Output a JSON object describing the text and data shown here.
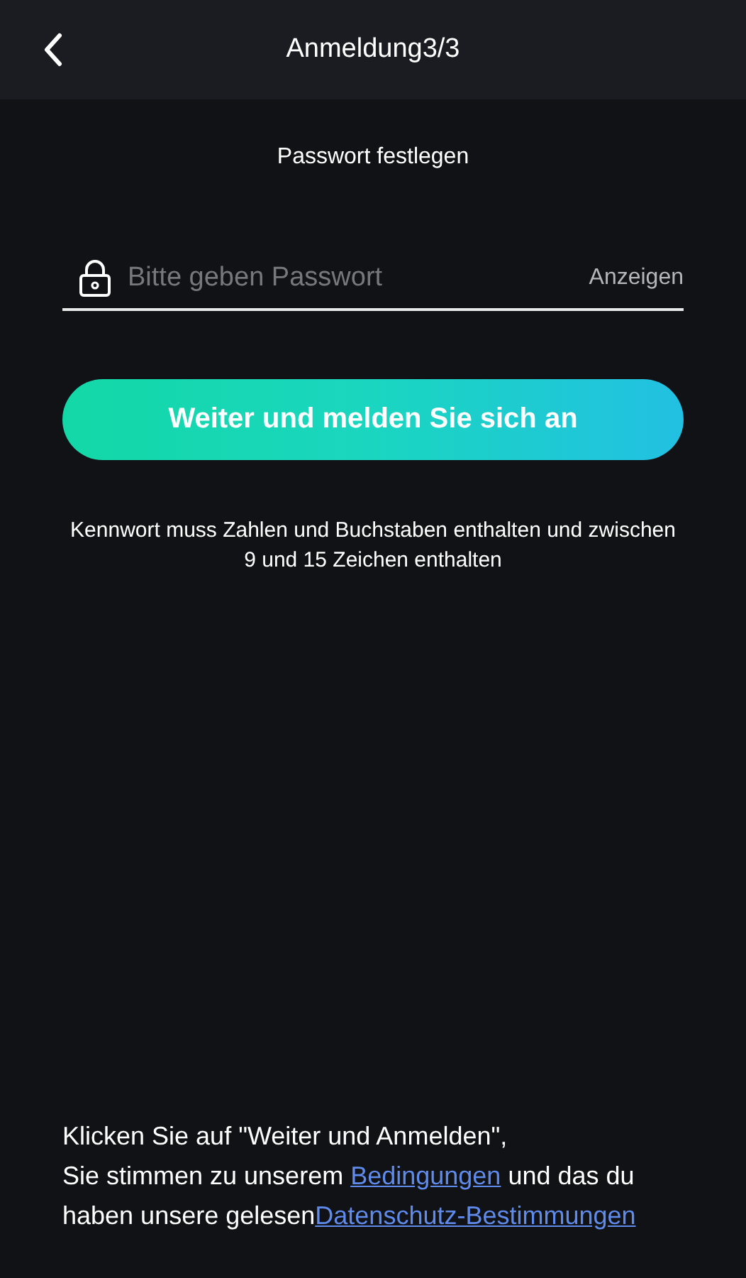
{
  "header": {
    "title": "Anmeldung3/3"
  },
  "heading": "Passwort festlegen",
  "password_field": {
    "placeholder": "Bitte geben Passwort",
    "toggle": "Anzeigen"
  },
  "submit_button": "Weiter und melden Sie sich an",
  "hint": "Kennwort muss Zahlen und Buchstaben enthalten und zwischen 9 und 15 Zeichen enthalten",
  "consent": [
    {
      "kind": "text",
      "text": "Klicken Sie auf \"Weiter und Anmelden\",\nSie stimmen zu unserem "
    },
    {
      "kind": "link",
      "text": "Bedingungen"
    },
    {
      "kind": "text",
      "text": " und das du\nhaben unsere gelesen"
    },
    {
      "kind": "link",
      "text": "Datenschutz-Bestimmungen"
    }
  ]
}
